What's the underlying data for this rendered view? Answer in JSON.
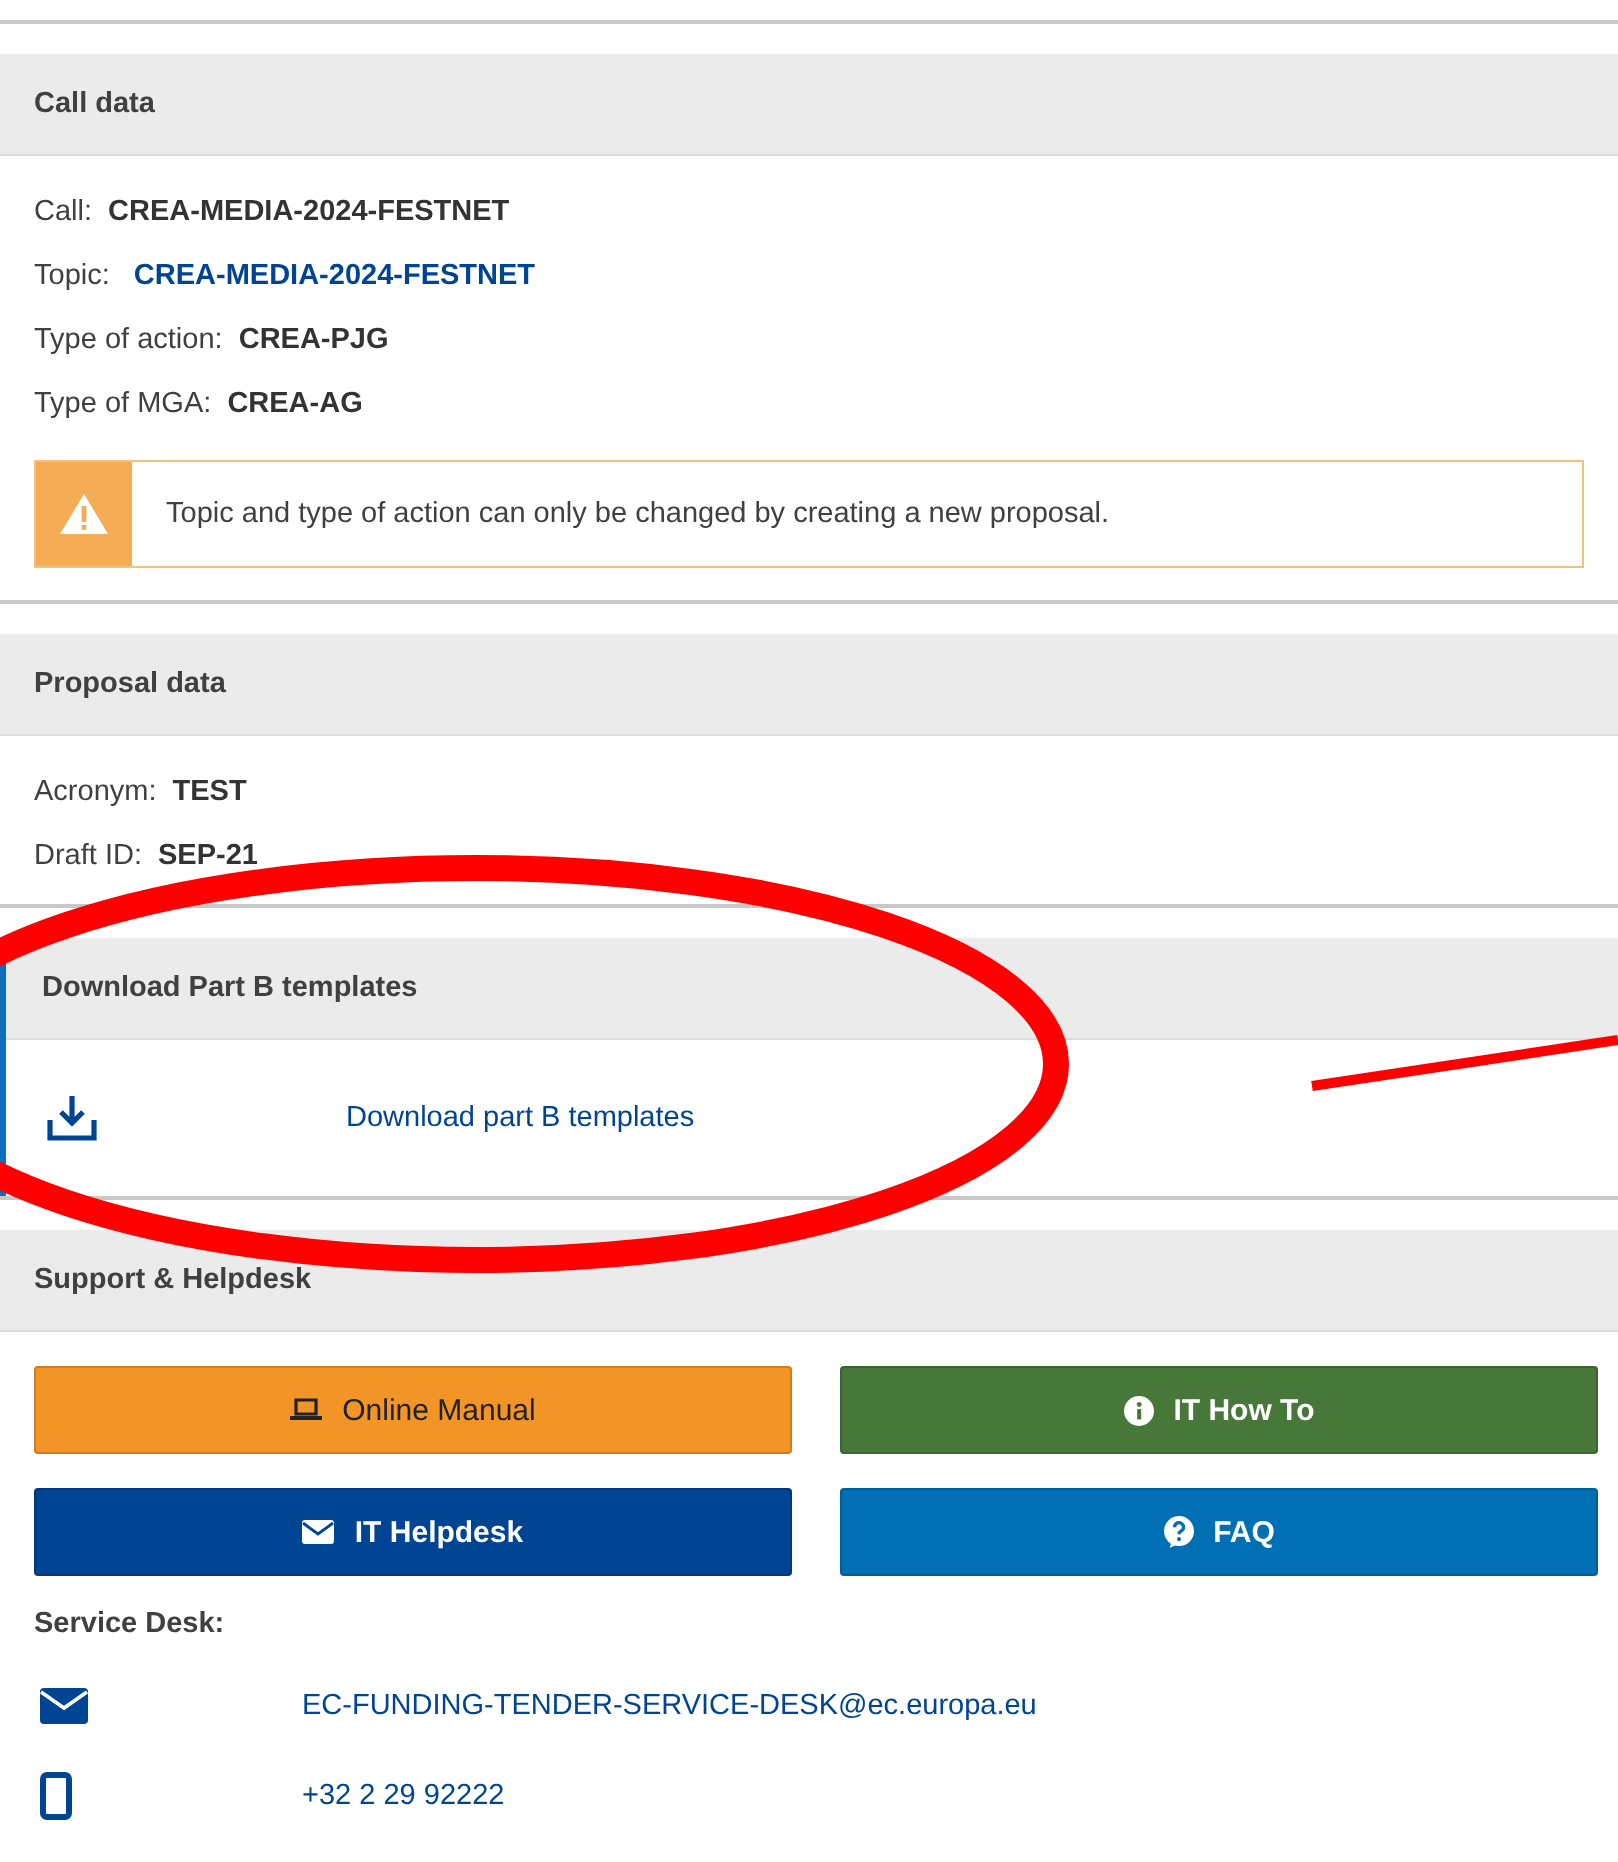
{
  "call_data": {
    "title": "Call data",
    "fields": [
      {
        "label": "Call:",
        "value": "CREA-MEDIA-2024-FESTNET",
        "kind": "text"
      },
      {
        "label": "Topic:",
        "value": "CREA-MEDIA-2024-FESTNET",
        "kind": "link"
      },
      {
        "label": "Type of action:",
        "value": "CREA-PJG",
        "kind": "text"
      },
      {
        "label": "Type of MGA:",
        "value": "CREA-AG",
        "kind": "text"
      }
    ],
    "warning": "Topic and type of action can only be changed by creating a new proposal."
  },
  "proposal_data": {
    "title": "Proposal data",
    "fields": [
      {
        "label": "Acronym:",
        "value": "TEST",
        "kind": "text"
      },
      {
        "label": "Draft ID:",
        "value": "SEP-21",
        "kind": "text"
      }
    ]
  },
  "download": {
    "title": "Download Part B templates",
    "link": "Download part B templates"
  },
  "support": {
    "title": "Support & Helpdesk",
    "buttons": [
      {
        "label": "Online Manual",
        "kind": "manual"
      },
      {
        "label": "IT How To",
        "kind": "howto"
      },
      {
        "label": "IT Helpdesk",
        "kind": "helpdesk"
      },
      {
        "label": "FAQ",
        "kind": "faq"
      }
    ],
    "service_desk_label": "Service Desk:",
    "contacts": [
      {
        "kind": "email",
        "value": "EC-FUNDING-TENDER-SERVICE-DESK@ec.europa.eu"
      },
      {
        "kind": "phone",
        "value": "+32 2 29 92222"
      }
    ]
  }
}
